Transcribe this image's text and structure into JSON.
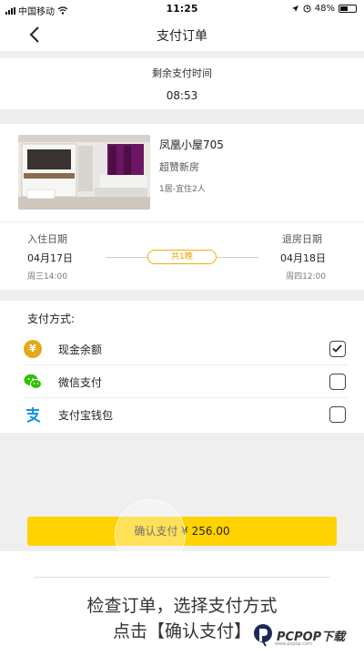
{
  "status_bar": {
    "carrier": "中国移动",
    "time": "11:25",
    "battery": "48%"
  },
  "nav": {
    "title": "支付订单"
  },
  "timer": {
    "label": "剩余支付时间",
    "value": "08:53"
  },
  "hotel": {
    "name": "凤凰小屋705",
    "tag": "超赞新房",
    "spec": "1居-宜住2人"
  },
  "stay": {
    "checkin_label": "入住日期",
    "checkin_date": "04月17日",
    "checkin_time": "周三14:00",
    "nights": "共1晚",
    "checkout_label": "退房日期",
    "checkout_date": "04月18日",
    "checkout_time": "周四12:00"
  },
  "payment": {
    "heading": "支付方式:",
    "options": [
      {
        "label": "现金余额",
        "icon": "cash-balance-icon",
        "checked": true
      },
      {
        "label": "微信支付",
        "icon": "wechat-icon",
        "checked": false
      },
      {
        "label": "支付宝钱包",
        "icon": "alipay-icon",
        "checked": false
      }
    ]
  },
  "confirm_button": "确认支付 ¥ 256.00",
  "instructions": {
    "line1": "检查订单，选择支付方式",
    "line2": "点击【确认支付】"
  },
  "watermark": {
    "brand": "PCPOP下载",
    "sub": "www.pcpop.com"
  },
  "colors": {
    "accent": "#ffd200",
    "nights_badge": "#e8a100",
    "coin": "#e3a91a",
    "wechat": "#2dc100",
    "alipay": "#1296db"
  }
}
